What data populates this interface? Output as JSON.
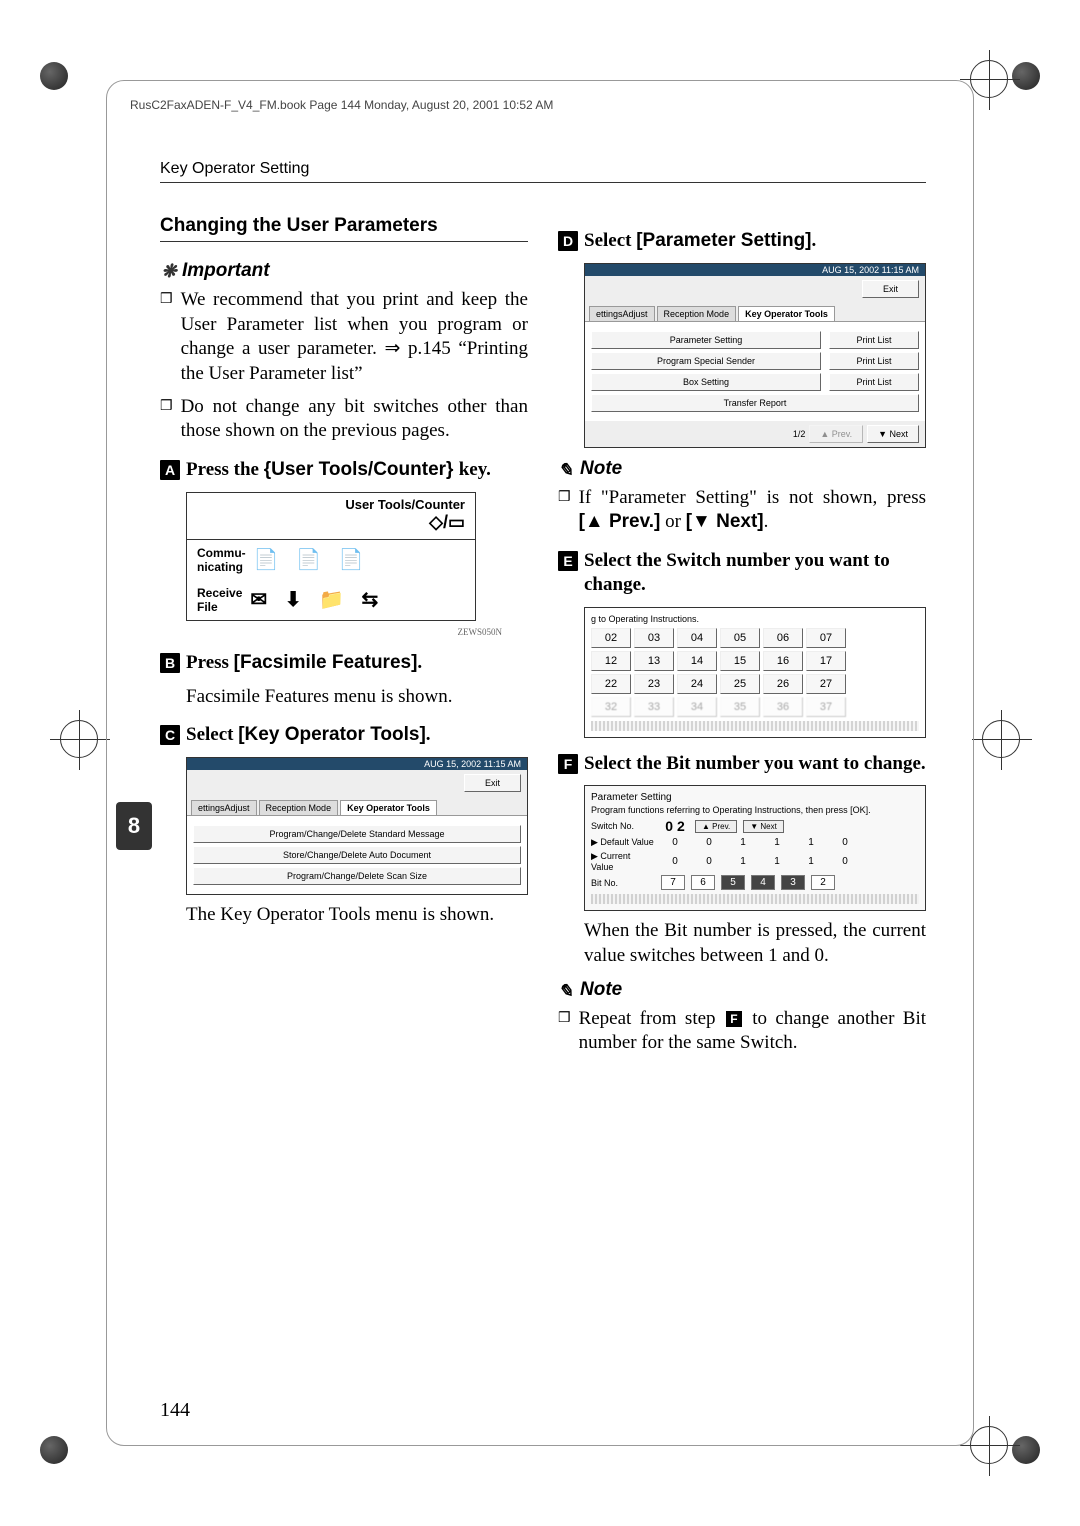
{
  "header_line": "RusC2FaxADEN-F_V4_FM.book  Page 144  Monday, August 20, 2001  10:52 AM",
  "running_head": "Key Operator Setting",
  "side_tab": "8",
  "page_number": "144",
  "left": {
    "section_title": "Changing the User Parameters",
    "important_label": "Important",
    "bullets": [
      "We recommend that you print and keep the User Parameter list when you program or change a user parameter. ⇒ p.145 “Printing the User Parameter list”",
      "Do not change any bit switches other than those shown on the previous pages."
    ],
    "step1": {
      "prefix": "Press the ",
      "key": "{User Tools/Counter} ",
      "suffix": "key."
    },
    "panel": {
      "title": "User Tools/Counter",
      "row1_label": "Commu-\nnicating",
      "row2_label": "Receive\nFile",
      "caption": "ZEWS050N"
    },
    "step2": {
      "prefix": "Press ",
      "btn": "[Facsimile Features]",
      "suffix": "."
    },
    "step2_sub": "Facsimile Features menu is shown.",
    "step3": {
      "prefix": "Select ",
      "btn": "[Key Operator Tools]",
      "suffix": "."
    },
    "screen3": {
      "timestamp": "AUG 15, 2002  11:15 AM",
      "exit": "Exit",
      "tabs": [
        "ettingsAdjust",
        "Reception Mode",
        "Key Operator Tools"
      ],
      "rows": [
        "Program/Change/Delete Standard Message",
        "Store/Change/Delete Auto Document",
        "Program/Change/Delete Scan Size"
      ]
    },
    "step3_sub": "The Key Operator Tools menu is shown."
  },
  "right": {
    "step4": {
      "prefix": "Select ",
      "btn": "[Parameter Setting]",
      "suffix": "."
    },
    "screen4": {
      "timestamp": "AUG 15, 2002  11:15 AM",
      "exit": "Exit",
      "tabs": [
        "ettingsAdjust",
        "Reception Mode",
        "Key Operator Tools"
      ],
      "rows": [
        {
          "name": "Parameter Setting",
          "action": "Print List"
        },
        {
          "name": "Program Special Sender",
          "action": "Print List"
        },
        {
          "name": "Box Setting",
          "action": "Print List"
        },
        {
          "name": "Transfer Report",
          "action": ""
        }
      ],
      "pager": {
        "pos": "1/2",
        "prev": "▲ Prev.",
        "next": "▼ Next"
      }
    },
    "note4_label": "Note",
    "note4_text_1": "If \"Parameter Setting\" is not shown, press ",
    "note4_prev": "[▲ Prev.]",
    "note4_or": " or ",
    "note4_next": "[▼ Next]",
    "note4_period": ".",
    "step5": "Select the Switch number you want to change.",
    "switch_screen": {
      "caption": "g to Operating Instructions.",
      "rows": [
        [
          "02",
          "03",
          "04",
          "05",
          "06",
          "07"
        ],
        [
          "12",
          "13",
          "14",
          "15",
          "16",
          "17"
        ],
        [
          "22",
          "23",
          "24",
          "25",
          "26",
          "27"
        ],
        [
          "32",
          "33",
          "34",
          "35",
          "36",
          "37"
        ]
      ]
    },
    "step6": "Select the Bit number you want to change.",
    "param_screen": {
      "title": "Parameter Setting",
      "subtitle": "Program functions referring to Operating Instructions, then press [OK].",
      "switch_label": "Switch No.",
      "switch_val": "0 2",
      "prev": "▲ Prev.",
      "next": "▼ Next",
      "default_label": "▶ Default Value",
      "default_vals": [
        "0",
        "0",
        "1",
        "1",
        "1",
        "0"
      ],
      "current_label": "▶ Current Value",
      "current_vals": [
        "0",
        "0",
        "1",
        "1",
        "1",
        "0"
      ],
      "bit_label": "Bit No.",
      "bit_vals": [
        "7",
        "6",
        "5",
        "4",
        "3",
        "2"
      ]
    },
    "step6_sub": "When the Bit number is pressed, the current value switches between 1 and 0.",
    "note6_label": "Note",
    "note6_text_1": "Repeat from step ",
    "note6_step": "F",
    "note6_text_2": " to change another Bit number for the same Switch."
  }
}
